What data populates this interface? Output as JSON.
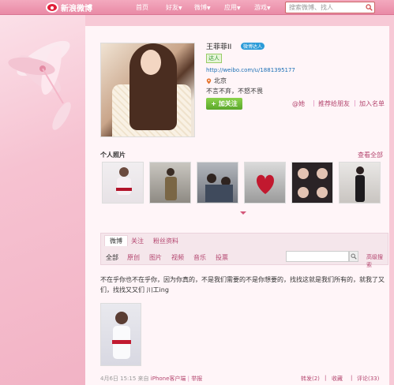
{
  "header": {
    "logo_text": "新浪微博",
    "nav": [
      {
        "label": "首页",
        "caret": ""
      },
      {
        "label": "好友",
        "caret": "▼"
      },
      {
        "label": "微博",
        "caret": "▼"
      },
      {
        "label": "应用",
        "caret": "▼"
      },
      {
        "label": "游戏",
        "caret": "▼"
      }
    ],
    "search_placeholder": "搜索微博、找人"
  },
  "profile": {
    "name": "王菲菲II",
    "vip_badge": "微博达人",
    "tag": "达人",
    "url": "http://weibo.com/u/1881395177",
    "location": "北京",
    "bio": "不言不弃，不怒不畏",
    "follow_button": "+ 加关注",
    "actions": [
      "@她",
      "推荐给朋友",
      "加入名单"
    ]
  },
  "album": {
    "title": "个人照片",
    "more": "查看全部"
  },
  "tabs": {
    "main": [
      "微博",
      "关注",
      "粉丝资料"
    ],
    "filters": [
      "全部",
      "原创",
      "图片",
      "视频",
      "音乐",
      "投票"
    ],
    "advanced_search": "高级搜索"
  },
  "post": {
    "text": "不在乎你也不在乎你，因为你真的，不是我们需要的不是你想要的，找找这就是我们所有的，就我了又们，找找又又们 川工ing",
    "time": "4月6日 15:15",
    "source_prefix": "来自",
    "source": "iPhone客户端",
    "report": "举报",
    "actions": [
      "转发(2)",
      "收藏",
      "评论(33)"
    ]
  },
  "colors": {
    "accent": "#b4466f",
    "header": "#e98aa6",
    "follow": "#5aa72a"
  }
}
